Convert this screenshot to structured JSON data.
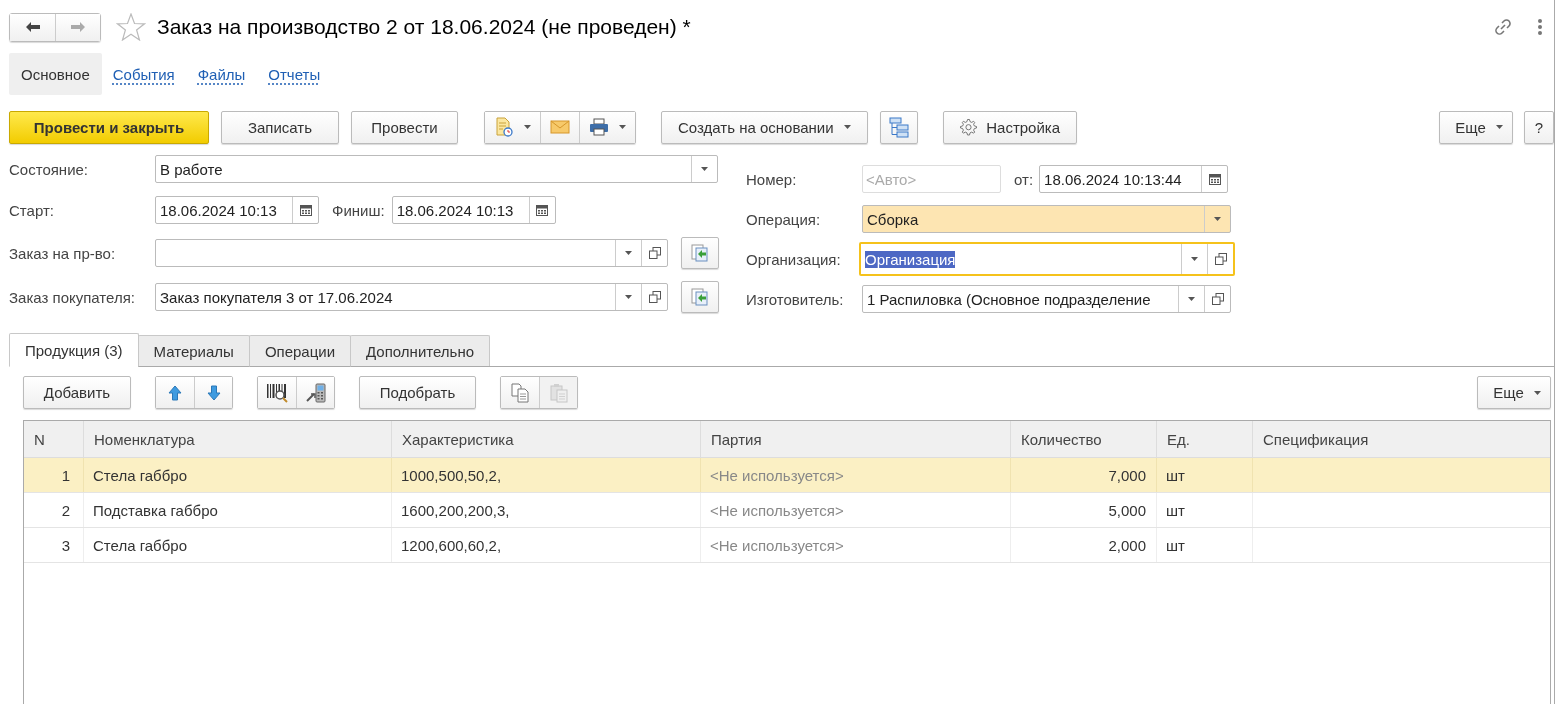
{
  "window": {
    "title": "Заказ на производство 2 от 18.06.2024 (не проведен) *"
  },
  "sections": [
    {
      "label": "Основное",
      "selected": true
    },
    {
      "label": "События",
      "selected": false
    },
    {
      "label": "Файлы",
      "selected": false
    },
    {
      "label": "Отчеты",
      "selected": false
    }
  ],
  "command_bar": {
    "post_close": "Провести и закрыть",
    "save": "Записать",
    "post": "Провести",
    "create_based": "Создать на основании",
    "settings": "Настройка",
    "more": "Еще",
    "help": "?"
  },
  "form": {
    "state": {
      "label": "Состояние:",
      "value": "В работе"
    },
    "start": {
      "label": "Старт:",
      "value": "18.06.2024 10:13"
    },
    "finish": {
      "label": "Финиш:",
      "value": "18.06.2024 10:13"
    },
    "production_order": {
      "label": "Заказ на пр-во:"
    },
    "customer_order": {
      "label": "Заказ покупателя:",
      "value": "Заказ покупателя 3 от 17.06.2024"
    },
    "number": {
      "label": "Номер:",
      "placeholder": "<Авто>"
    },
    "date": {
      "label": "от:",
      "value": "18.06.2024 10:13:44"
    },
    "operation": {
      "label": "Операция:",
      "value": "Сборка",
      "highlighted": true
    },
    "organization": {
      "label": "Организация:",
      "value": "Организация",
      "focused": true,
      "text_selected": true
    },
    "manufacturer": {
      "label": "Изготовитель:",
      "value": "1 Распиловка (Основное подразделение"
    }
  },
  "tabs": [
    {
      "label": "Продукция (3)",
      "selected": true
    },
    {
      "label": "Материалы",
      "selected": false
    },
    {
      "label": "Операции",
      "selected": false
    },
    {
      "label": "Дополнительно",
      "selected": false
    }
  ],
  "toolbar": {
    "add": "Добавить",
    "pick": "Подобрать",
    "more": "Еще",
    "paste_disabled": true
  },
  "table": {
    "columns": [
      "N",
      "Номенклатура",
      "Характеристика",
      "Партия",
      "Количество",
      "Ед.",
      "Спецификация"
    ],
    "rows": [
      {
        "selected": true,
        "cells": [
          "1",
          "Стела габбро",
          "1000,500,50,2,",
          "<Не используется>",
          "7,000",
          "шт"
        ]
      },
      {
        "selected": false,
        "cells": [
          "2",
          "Подставка габбро",
          "1600,200,200,3,",
          "<Не используется>",
          "5,000",
          "шт"
        ]
      },
      {
        "selected": false,
        "cells": [
          "3",
          "Стела габбро",
          "1200,600,60,2,",
          "<Не используется>",
          "2,000",
          "шт"
        ]
      }
    ]
  }
}
